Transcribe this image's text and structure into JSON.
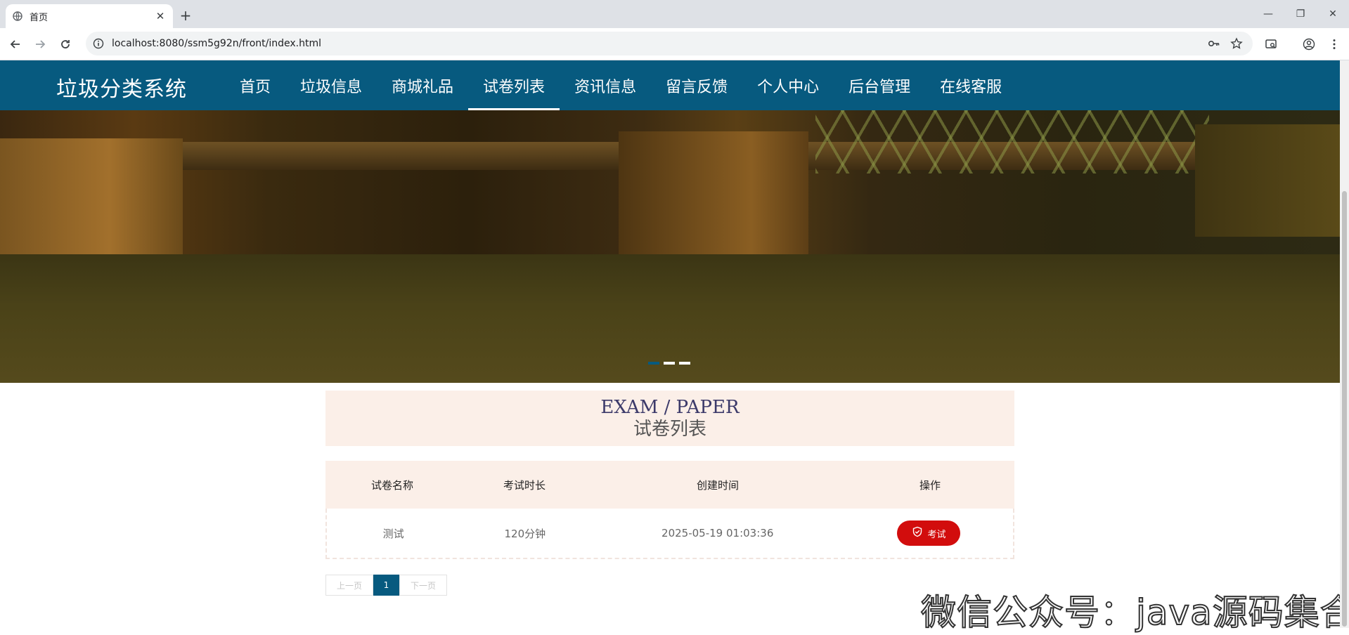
{
  "browser": {
    "tab_title": "首页",
    "new_tab_symbol": "+",
    "close_symbol": "✕",
    "url": "localhost:8080/ssm5g92n/front/index.html",
    "win_minimize": "—",
    "win_restore": "❐",
    "win_close": "✕"
  },
  "header": {
    "logo": "垃圾分类系统",
    "nav": [
      {
        "label": "首页"
      },
      {
        "label": "垃圾信息"
      },
      {
        "label": "商城礼品"
      },
      {
        "label": "试卷列表"
      },
      {
        "label": "资讯信息"
      },
      {
        "label": "留言反馈"
      },
      {
        "label": "个人中心"
      },
      {
        "label": "后台管理"
      },
      {
        "label": "在线客服"
      }
    ],
    "active_index": 3,
    "color": "#075a7f"
  },
  "banner": {
    "slide_count": 3,
    "active_slide": 0
  },
  "section": {
    "title_en": "EXAM / PAPER",
    "title_cn": "试卷列表"
  },
  "table": {
    "columns": [
      "试卷名称",
      "考试时长",
      "创建时间",
      "操作"
    ],
    "rows": [
      {
        "name": "测试",
        "duration": "120分钟",
        "created": "2025-05-19 01:03:36",
        "action": "考试"
      }
    ],
    "action_color": "#d20d0d"
  },
  "pagination": {
    "prev": "上一页",
    "current": "1",
    "next": "下一页"
  },
  "watermark": "微信公众号：java源码集合"
}
